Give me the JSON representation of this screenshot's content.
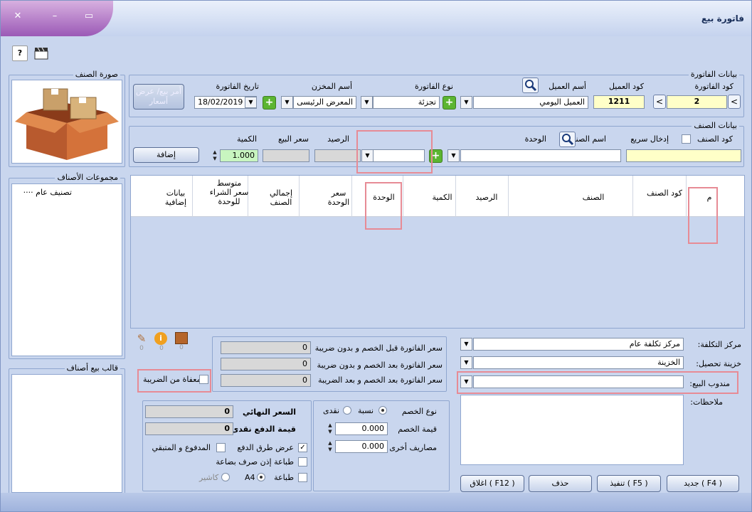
{
  "window": {
    "title": "فاتورة بيع"
  },
  "toolbar": {
    "help_icon": "help-icon",
    "clapper_icon": "clapper-icon"
  },
  "invoice": {
    "group_label": "بيانات الفاتورة",
    "invoice_code_label": "كود الفاتورة",
    "invoice_code": "2",
    "customer_code_label": "كود العميل",
    "customer_code": "1211",
    "customer_name_label": "أسم العميل",
    "customer_name": "العميل اليومي",
    "invoice_type_label": "نوع الفاتورة",
    "invoice_type": "تجزئة",
    "warehouse_label": "أسم المخزن",
    "warehouse": "المعرض الرئيسى",
    "date_label": "تاريخ الفاتورة",
    "date": "18/02/2019",
    "price_order_button": "أمر بيع/ عرض أسعار"
  },
  "item_image": {
    "label": "صورة الصنف"
  },
  "item": {
    "group_label": "بيانات الصنف",
    "code_label": "كود الصنف",
    "quick_entry_label": "إدخال سريع",
    "name_label": "اسم الصنف",
    "unit_label": "الوحدة",
    "balance_label": "الرصيد",
    "sale_price_label": "سعر البيع",
    "quantity_label": "الكمية",
    "quantity": "1.000",
    "add_button": "إضافة"
  },
  "categories": {
    "label": "مجموعات الأصناف",
    "items": [
      "تصنيف عام"
    ]
  },
  "templates": {
    "label": "قالب بيع أصناف"
  },
  "grid": {
    "columns": [
      "م",
      "كود الصنف",
      "الصنف",
      "الرصيد",
      "الكمية",
      "الوحدة",
      "سعر الوحدة",
      "إجمالي الصنف",
      "متوسط سعر الشراء للوحدة",
      "بيانات إضافية"
    ]
  },
  "indicators": {
    "attach_count": "0",
    "info_count": "0",
    "box_count": "0"
  },
  "tax_exempt": {
    "label": "معفاة من الضريبة"
  },
  "totals": {
    "before_discount_label": "سعر الفاتورة قبل الخصم و بدون ضريبة",
    "before_discount": "0",
    "after_discount_label": "سعر الفاتورة بعد الخصم و بدون ضريبة",
    "after_discount": "0",
    "after_tax_label": "سعر الفاتورة بعد الخصم و بعد الضريبة",
    "after_tax": "0"
  },
  "right_panel": {
    "cost_center_label": "مركز التكلفة:",
    "cost_center": "مركز تكلفة عام",
    "treasury_label": "خزينة تحصيل:",
    "treasury": "الخزينة",
    "salesman_label": "مندوب البيع:",
    "salesman": "",
    "notes_label": "ملاحظات:"
  },
  "discount": {
    "type_label": "نوع الخصم",
    "percent_label": "نسبة",
    "cash_label": "نقدى",
    "value_label": "قيمة الخصم",
    "value": "0.000",
    "other_label": "مصاريف أخرى",
    "other": "0.000"
  },
  "final": {
    "final_price_label": "السعر النهائي",
    "final_price": "0",
    "cash_label": "قيمة الدفع نقدى",
    "cash": "0",
    "show_payment_label": "عرض طرق الدفع",
    "paid_remaining_label": "المدفوع و المتبقي",
    "print_permit_label": "طباعة إذن صرف بضاعة",
    "print_label": "طباعة",
    "a4_label": "A4",
    "cashier_label": "كاشير"
  },
  "actions": {
    "new": "جديد ( F4 )",
    "execute": "تنفيذ ( F5 )",
    "delete": "حذف",
    "close": "اغلاق ( F12 )"
  }
}
